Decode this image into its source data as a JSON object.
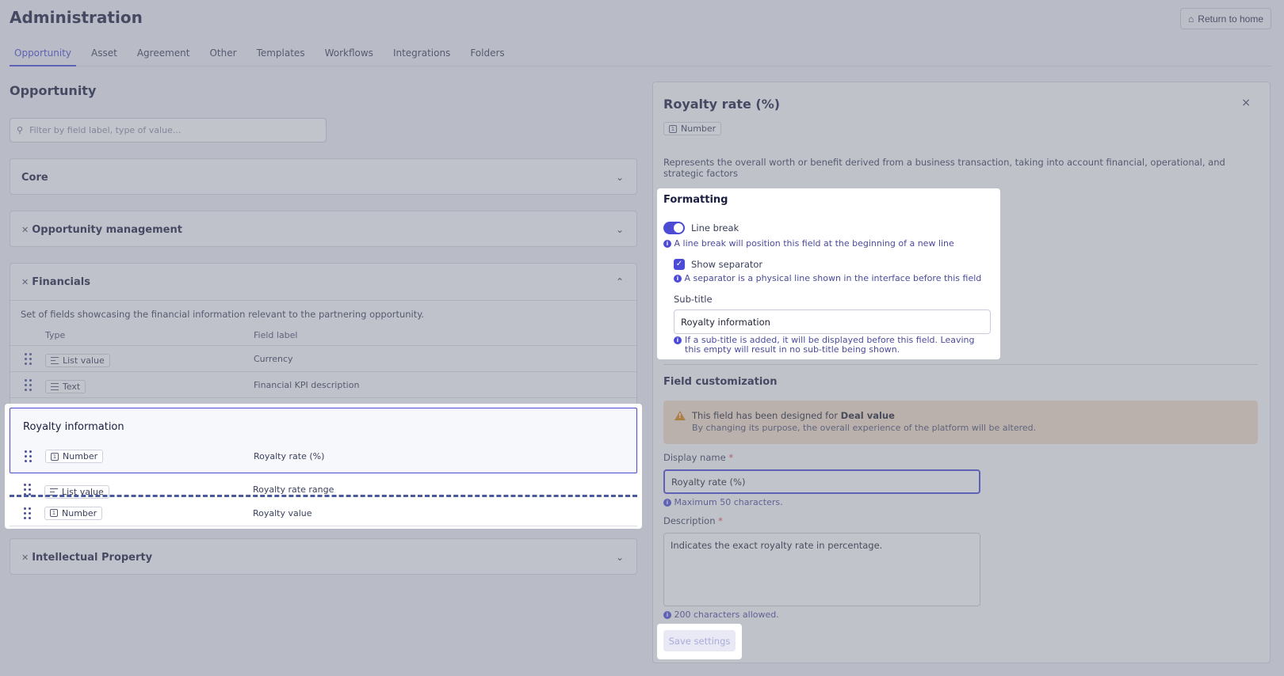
{
  "header": {
    "title": "Administration",
    "return_label": "Return to home",
    "tabs": [
      "Opportunity",
      "Asset",
      "Agreement",
      "Other",
      "Templates",
      "Workflows",
      "Integrations",
      "Folders"
    ]
  },
  "left": {
    "title": "Opportunity",
    "search_placeholder": "Filter by field label, type of value...",
    "cards": {
      "core": "Core",
      "opp_mgmt": "Opportunity management",
      "financials": "Financials",
      "ip": "Intellectual Property"
    },
    "financials_desc": "Set of fields showcasing the financial information relevant to the partnering opportunity.",
    "table_headers": {
      "type": "Type",
      "label": "Field label"
    },
    "rows": [
      {
        "type": "List value",
        "label": "Currency"
      },
      {
        "type": "Text",
        "label": "Financial KPI description"
      }
    ],
    "subtitle_group": "Royalty information",
    "highlight_rows": [
      {
        "type": "Number",
        "label": "Royalty rate (%)"
      },
      {
        "type": "List value",
        "label": "Royalty rate range"
      },
      {
        "type": "Number",
        "label": "Royalty value"
      }
    ]
  },
  "panel": {
    "title": "Royalty rate (%)",
    "close": "×",
    "type": "Number",
    "description": "Represents the overall worth or benefit derived from a business transaction, taking into account financial, operational, and strategic factors",
    "formatting": {
      "heading": "Formatting",
      "line_break_label": "Line break",
      "line_break_hint": "A line break will position this field at the beginning of a new line",
      "separator_label": "Show separator",
      "separator_hint": "A separator is a physical line shown in the interface before this field",
      "subtitle_label": "Sub-title",
      "subtitle_value": "Royalty information",
      "subtitle_hint": "If a sub-title is added, it will be displayed before this field. Leaving this empty will result in no sub-title being shown."
    },
    "customization": {
      "heading": "Field customization",
      "warn_prefix": "This field has been designed for ",
      "warn_bold": "Deal value",
      "warn_line2": "By changing its purpose, the overall experience of the platform will be altered.",
      "display_name_label": "Display name",
      "display_name_value": "Royalty rate (%)",
      "display_name_hint": "Maximum 50 characters.",
      "description_label": "Description",
      "description_value": "Indicates the exact royalty rate in percentage.",
      "description_hint": "200 characters allowed.",
      "required_mark": "*"
    },
    "save_label": "Save settings"
  }
}
